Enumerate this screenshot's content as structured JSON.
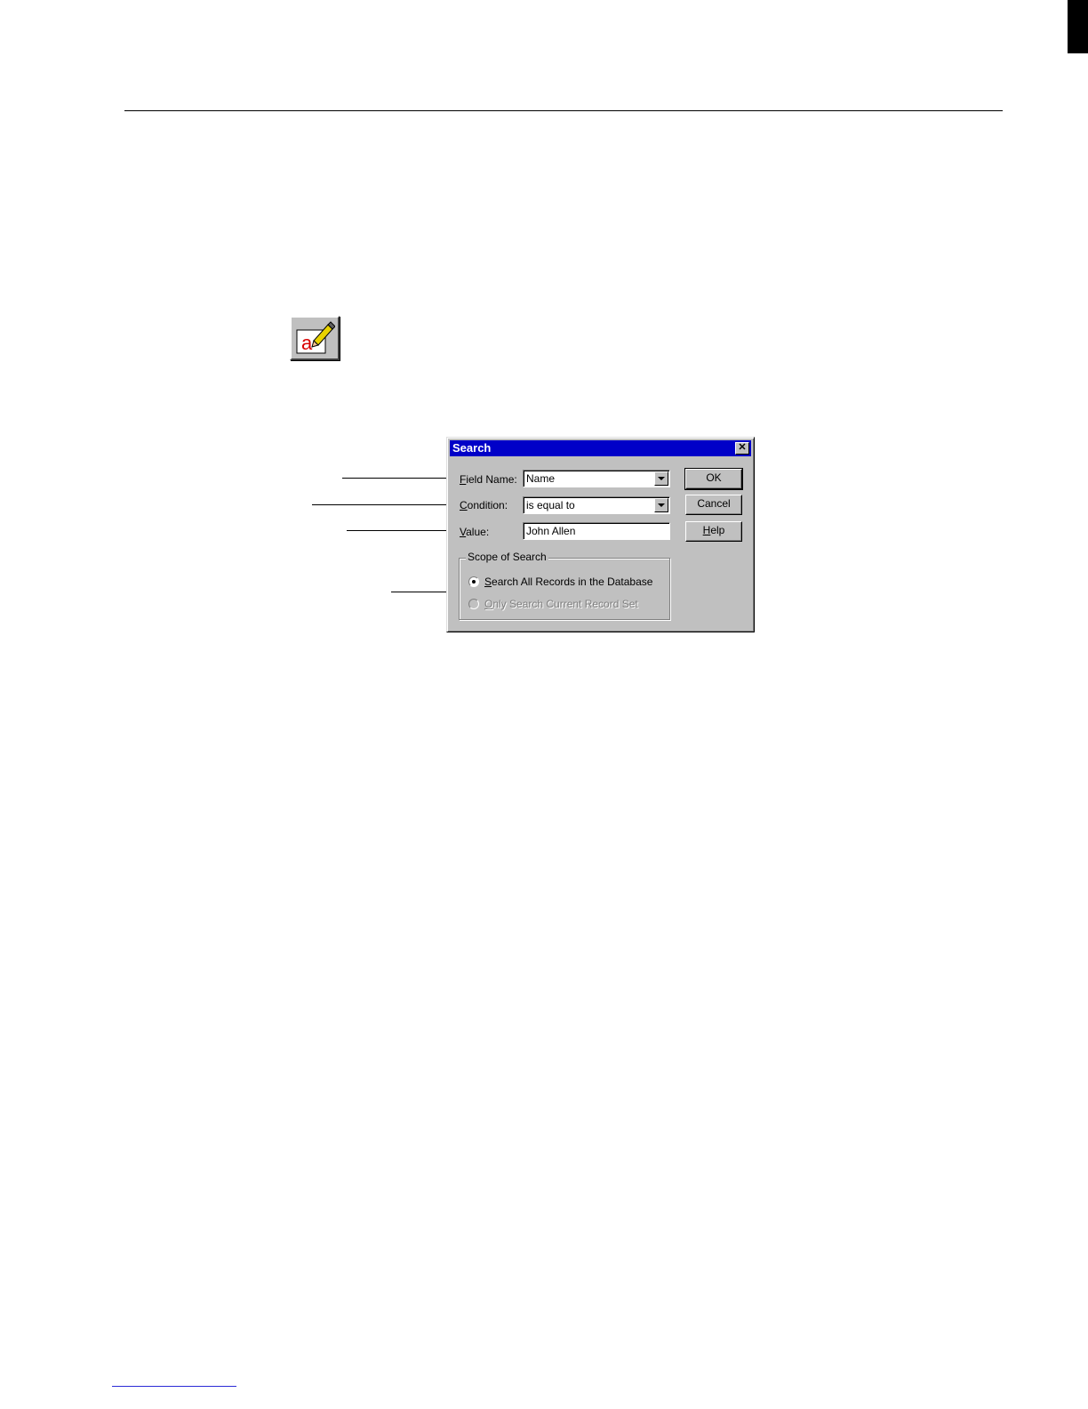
{
  "dialog": {
    "title": "Search",
    "close_glyph": "✕",
    "field_name": {
      "label_accel": "F",
      "label_rest": "ield Name:",
      "value": "Name"
    },
    "condition": {
      "label_accel": "C",
      "label_rest": "ondition:",
      "value": "is equal to"
    },
    "value_field": {
      "label_accel": "V",
      "label_rest": "alue:",
      "value": "John Allen"
    },
    "buttons": {
      "ok": "OK",
      "cancel": "Cancel",
      "help_accel": "H",
      "help_rest": "elp"
    },
    "scope": {
      "legend": "Scope of Search",
      "options": [
        {
          "accel": "S",
          "rest": "earch All Records in the Database",
          "checked": true,
          "enabled": true
        },
        {
          "accel": "O",
          "rest": "nly Search Current Record Set",
          "checked": false,
          "enabled": false
        }
      ]
    }
  },
  "toolbar": {
    "icon": "edit-text-pencil-icon",
    "icon_letter": "a"
  },
  "colors": {
    "titlebar": "#0000c8",
    "dialog_face": "#c0c0c0",
    "icon_letter": "#d80000"
  }
}
